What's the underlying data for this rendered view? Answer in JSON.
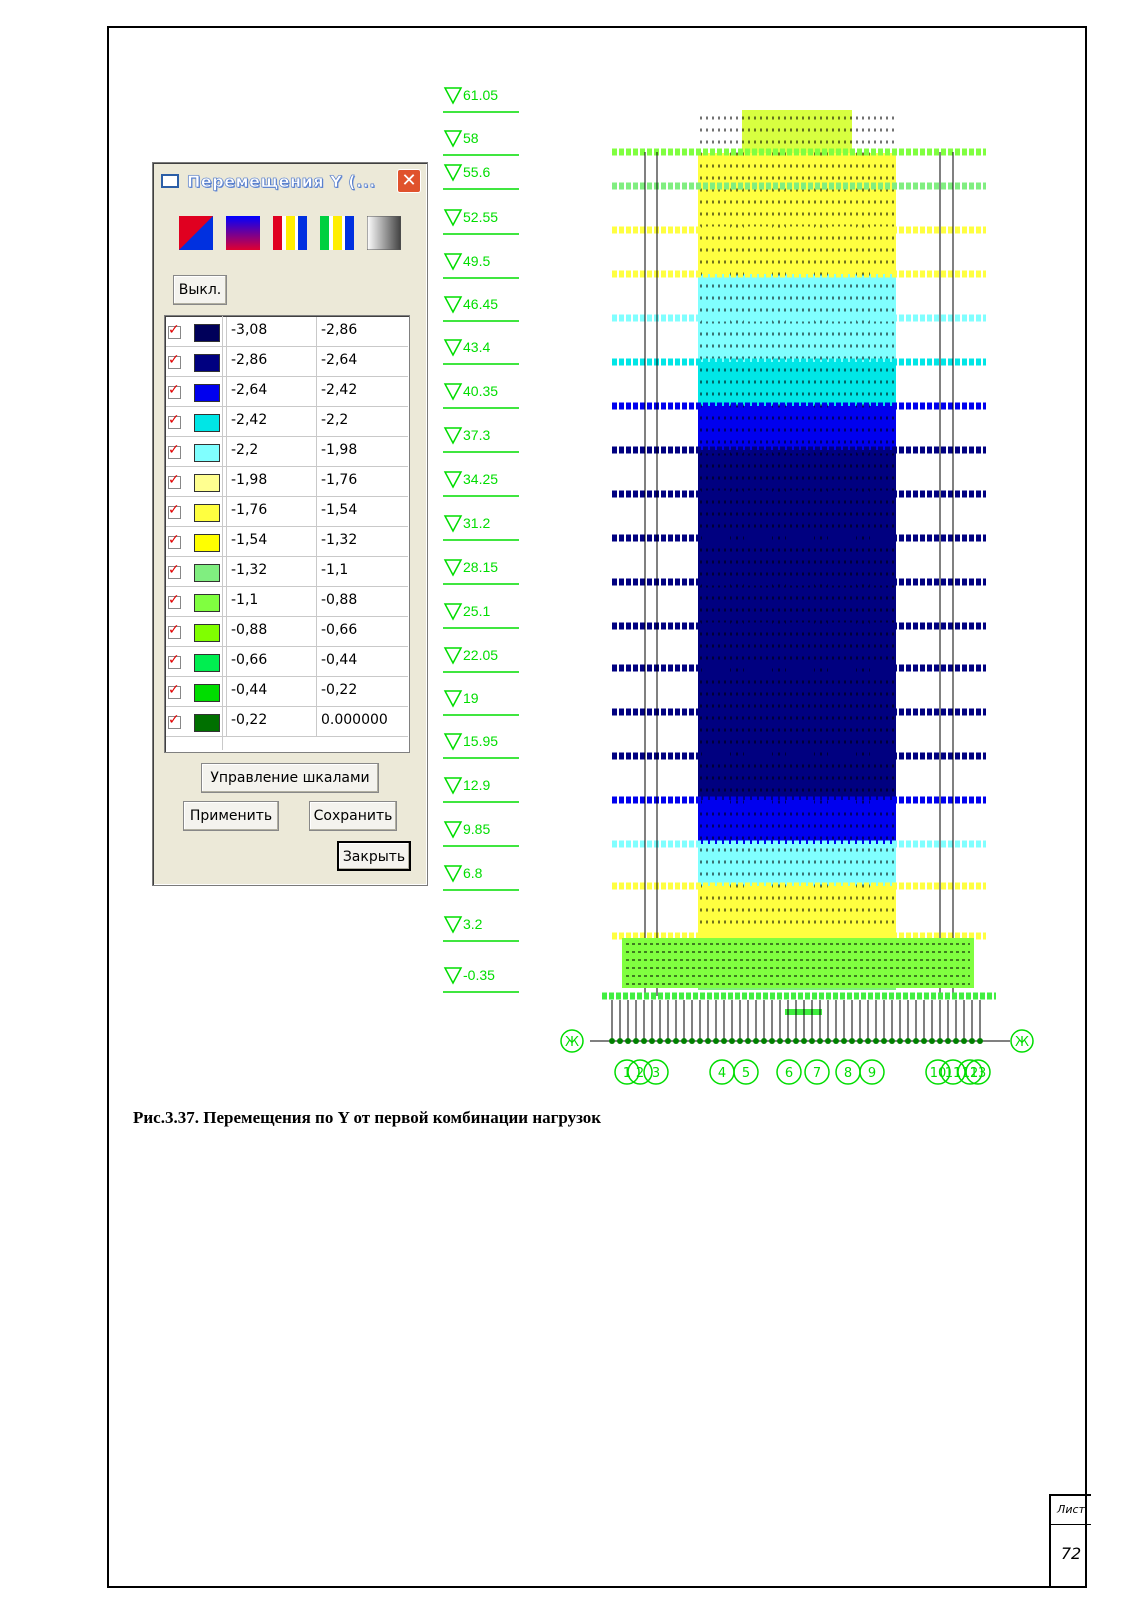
{
  "dialog": {
    "title": "Перемещения Y (...",
    "off_label": "Выкл.",
    "scale_control_label": "Управление шкалами",
    "apply_label": "Применить",
    "save_label": "Сохранить",
    "close_label": "Закрыть",
    "legend": [
      {
        "from": "-3,08",
        "to": "-2,86",
        "color": "#00005a"
      },
      {
        "from": "-2,86",
        "to": "-2,64",
        "color": "#000080"
      },
      {
        "from": "-2,64",
        "to": "-2,42",
        "color": "#0000ee"
      },
      {
        "from": "-2,42",
        "to": "-2,2",
        "color": "#00e6e6"
      },
      {
        "from": "-2,2",
        "to": "-1,98",
        "color": "#80ffff"
      },
      {
        "from": "-1,98",
        "to": "-1,76",
        "color": "#ffff90"
      },
      {
        "from": "-1,76",
        "to": "-1,54",
        "color": "#ffff40"
      },
      {
        "from": "-1,54",
        "to": "-1,32",
        "color": "#ffff00"
      },
      {
        "from": "-1,32",
        "to": "-1,1",
        "color": "#80ee80"
      },
      {
        "from": "-1,1",
        "to": "-0,88",
        "color": "#80ff40"
      },
      {
        "from": "-0,88",
        "to": "-0,66",
        "color": "#80ff00"
      },
      {
        "from": "-0,66",
        "to": "-0,44",
        "color": "#00ee50"
      },
      {
        "from": "-0,44",
        "to": "-0,22",
        "color": "#00dd00"
      },
      {
        "from": "-0,22",
        "to": "0.000000",
        "color": "#007000"
      }
    ]
  },
  "levels": [
    "61.05",
    "58",
    "55.6",
    "52.55",
    "49.5",
    "46.45",
    "43.4",
    "40.35",
    "37.3",
    "34.25",
    "31.2",
    "28.15",
    "25.1",
    "22.05",
    "19",
    "15.95",
    "12.9",
    "9.85",
    "6.8",
    "3.2",
    "-0.35"
  ],
  "axes": {
    "row_label": "Ж",
    "column_labels": [
      "1",
      "2",
      "3",
      "4",
      "5",
      "6",
      "7",
      "8",
      "9",
      "10",
      "11",
      "12",
      "13"
    ]
  },
  "caption": "Рис.3.37. Перемещения по Y от первой комбинации нагрузок",
  "sheet": {
    "label": "Лист",
    "number": "72"
  },
  "floor_colors": [
    "#d8ff40",
    "#40ff30",
    "#60ff80",
    "#80ee80",
    "#80ee80",
    "#ffff40",
    "#80ffff",
    "#ffff40",
    "#80ffff",
    "#00e6e6",
    "#00e6e6",
    "#0000ee",
    "#000080",
    "#000080",
    "#000080",
    "#000080",
    "#000080",
    "#000080",
    "#000080",
    "#0000ee",
    "#80ffff",
    "#ffff40",
    "#80ee80",
    "#40ff30",
    "#40ee40"
  ],
  "accent_green": "#00dd00"
}
